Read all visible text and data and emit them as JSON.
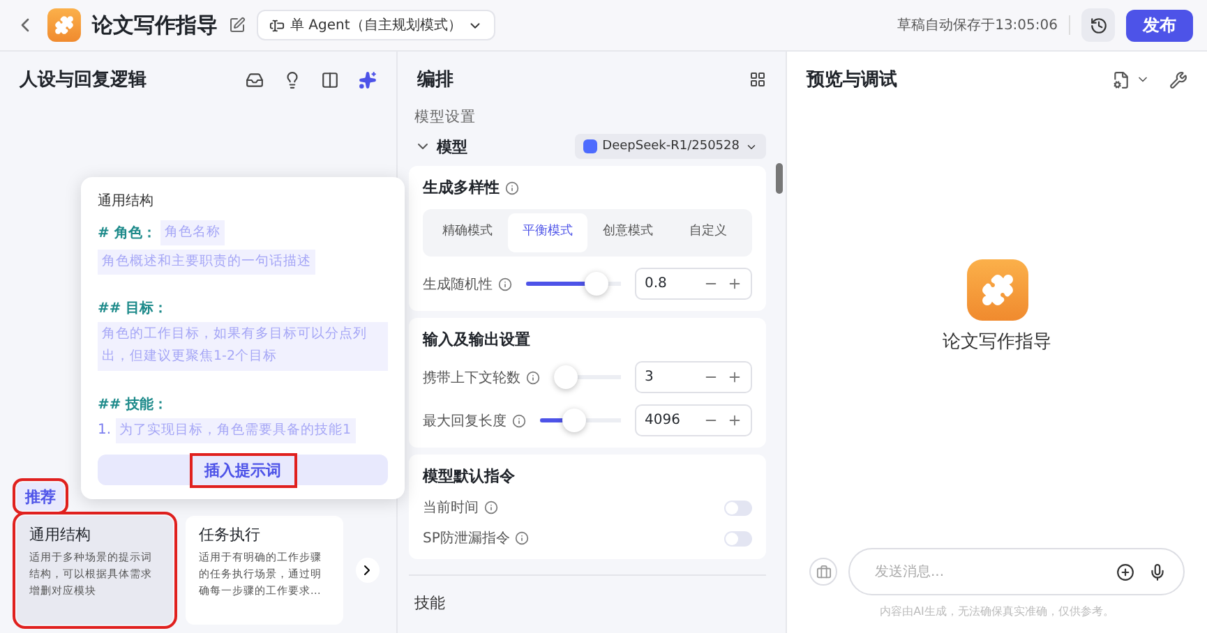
{
  "top_bar": {
    "title": "论文写作指导",
    "mode_select": "单 Agent（自主规划模式）",
    "save_status": "草稿自动保存于13:05:06",
    "publish_button": "发布"
  },
  "persona_panel": {
    "title": "人设与回复逻辑",
    "template_tabs": [
      {
        "label": "推荐",
        "selected": true,
        "annotated": true
      }
    ],
    "template_cards": [
      {
        "title": "通用结构",
        "description": "适用于多种场景的提示词结构，可以根据具体需求增删对应模块",
        "selected": true,
        "annotated": true
      },
      {
        "title": "任务执行",
        "description": "适用于有明确的工作步骤的任务执行场景，通过明确每一步骤的工作要求…",
        "selected": false,
        "annotated": false
      }
    ]
  },
  "template_popover": {
    "title": "通用结构",
    "blocks": [
      {
        "heading": "# 角色：",
        "inline": "角色名称",
        "placeholders": [
          "角色概述和主要职责的一句话描述"
        ]
      },
      {
        "heading": "## 目标：",
        "placeholders": [
          "角色的工作目标，如果有多目标可以分点列出，但建议更聚焦1-2个目标"
        ]
      },
      {
        "heading": "## 技能：",
        "items": [
          {
            "number": "1.",
            "text": "为了实现目标，角色需要具备的技能1"
          }
        ]
      }
    ],
    "insert_button": {
      "label": "插入提示词",
      "annotated": true
    }
  },
  "orchestration": {
    "title": "编排",
    "section_label": "模型设置",
    "model_label": "模型",
    "model_expanded": true,
    "model_select": "DeepSeek-R1/250528",
    "diversity": {
      "title": "生成多样性",
      "modes": [
        {
          "label": "精确模式",
          "selected": false
        },
        {
          "label": "平衡模式",
          "selected": true
        },
        {
          "label": "创意模式",
          "selected": false
        },
        {
          "label": "自定义",
          "selected": false
        }
      ],
      "randomness": {
        "label": "生成随机性",
        "level": 0.82,
        "value": "0.8"
      }
    },
    "io": {
      "title": "输入及输出设置",
      "rows": [
        {
          "label": "携带上下文轮数",
          "level": 0,
          "value": "3"
        },
        {
          "label": "最大回复长度",
          "level": 0.4,
          "value": "4096"
        }
      ]
    },
    "default_instructions": {
      "title": "模型默认指令",
      "toggles": [
        {
          "label": "当前时间",
          "on": false
        },
        {
          "label": "SP防泄漏指令",
          "on": false
        }
      ]
    },
    "next_section": "技能"
  },
  "preview": {
    "title": "预览与调试",
    "app_name": "论文写作指导",
    "message_placeholder": "发送消息...",
    "disclaimer": "内容由AI生成，无法确保真实准确，仅供参考。"
  }
}
